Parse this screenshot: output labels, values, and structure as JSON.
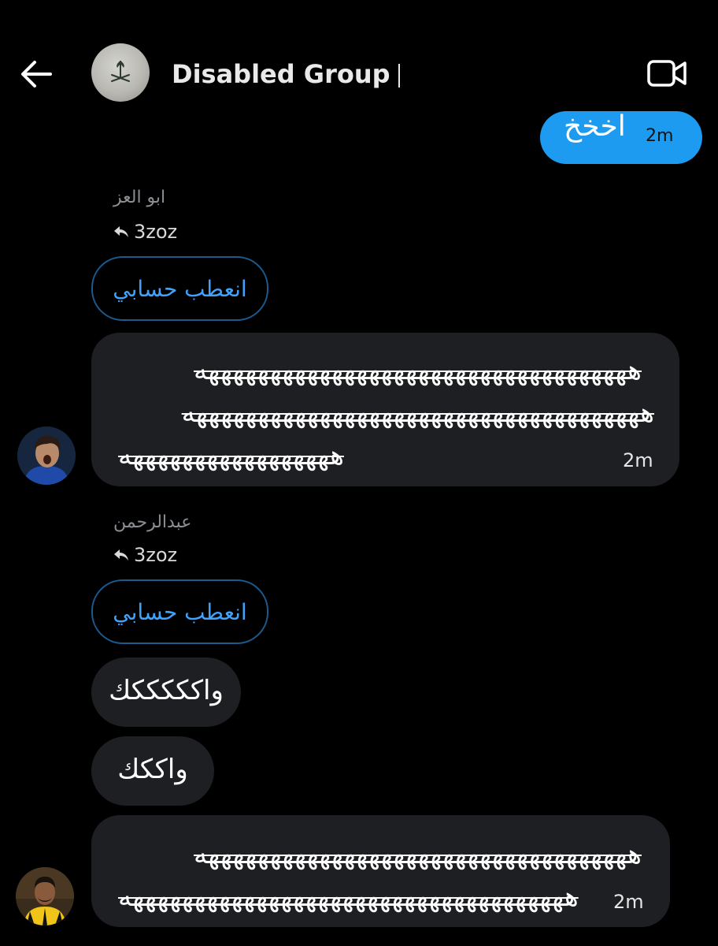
{
  "header": {
    "title": "Disabled Group",
    "back_icon": "arrow-left-icon",
    "video_icon": "video-camera-icon"
  },
  "messages": {
    "outgoing": {
      "text": "اخخخ",
      "time": "2m"
    },
    "group1": {
      "sender": "ابو العز",
      "reply_to": "3zoz",
      "quote": "انعطب حسابي",
      "lines": [
        "هههههههههههههههههههههههههههههههههههه",
        "هههههههههههههههههههههههههههههههههههههه",
        "هههههههههههههههههه"
      ],
      "time": "2m"
    },
    "group2": {
      "sender": "عبدالرحمن",
      "reply_to": "3zoz",
      "quote": "انعطب حسابي",
      "msg1": "واكككككك",
      "msg2": "واككك",
      "lines": [
        "هههههههههههههههههههههههههههههههههههه",
        "ههههههههههههههههههههههههههههههههههههه"
      ],
      "time": "2m"
    }
  },
  "colors": {
    "background": "#000000",
    "outgoing_bubble": "#1d9bf0",
    "incoming_bubble": "#1e1f22",
    "quote_border": "#1a5a8f",
    "quote_text": "#3ea3ff"
  }
}
